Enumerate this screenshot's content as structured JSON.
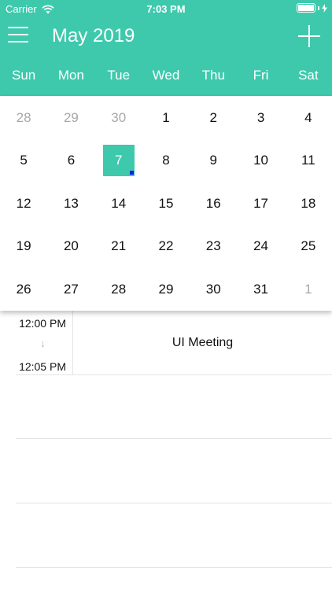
{
  "status_bar": {
    "carrier": "Carrier",
    "time": "7:03 PM",
    "wifi_icon": "wifi-icon",
    "battery_icon": "battery-icon",
    "charging_icon": "bolt-icon"
  },
  "nav": {
    "title": "May 2019",
    "menu_icon": "hamburger-menu-icon",
    "add_icon": "plus-icon"
  },
  "weekdays": [
    "Sun",
    "Mon",
    "Tue",
    "Wed",
    "Thu",
    "Fri",
    "Sat"
  ],
  "calendar": {
    "weeks": [
      [
        {
          "d": "28",
          "outside": true
        },
        {
          "d": "29",
          "outside": true
        },
        {
          "d": "30",
          "outside": true
        },
        {
          "d": "1"
        },
        {
          "d": "2"
        },
        {
          "d": "3"
        },
        {
          "d": "4"
        }
      ],
      [
        {
          "d": "5"
        },
        {
          "d": "6"
        },
        {
          "d": "7",
          "selected": true,
          "has_event": true
        },
        {
          "d": "8"
        },
        {
          "d": "9"
        },
        {
          "d": "10"
        },
        {
          "d": "11"
        }
      ],
      [
        {
          "d": "12"
        },
        {
          "d": "13"
        },
        {
          "d": "14"
        },
        {
          "d": "15"
        },
        {
          "d": "16"
        },
        {
          "d": "17"
        },
        {
          "d": "18"
        }
      ],
      [
        {
          "d": "19"
        },
        {
          "d": "20"
        },
        {
          "d": "21"
        },
        {
          "d": "22"
        },
        {
          "d": "23"
        },
        {
          "d": "24"
        },
        {
          "d": "25"
        }
      ],
      [
        {
          "d": "26"
        },
        {
          "d": "27"
        },
        {
          "d": "28"
        },
        {
          "d": "29"
        },
        {
          "d": "30"
        },
        {
          "d": "31"
        },
        {
          "d": "1",
          "outside": true
        }
      ]
    ]
  },
  "events": [
    {
      "start": "12:00 PM",
      "arrow": "↓",
      "end": "12:05 PM",
      "title": "UI Meeting"
    }
  ],
  "colors": {
    "accent": "#3ec9ad",
    "event_dot": "#0a1fe0",
    "outside_day": "#a8a8a8"
  }
}
